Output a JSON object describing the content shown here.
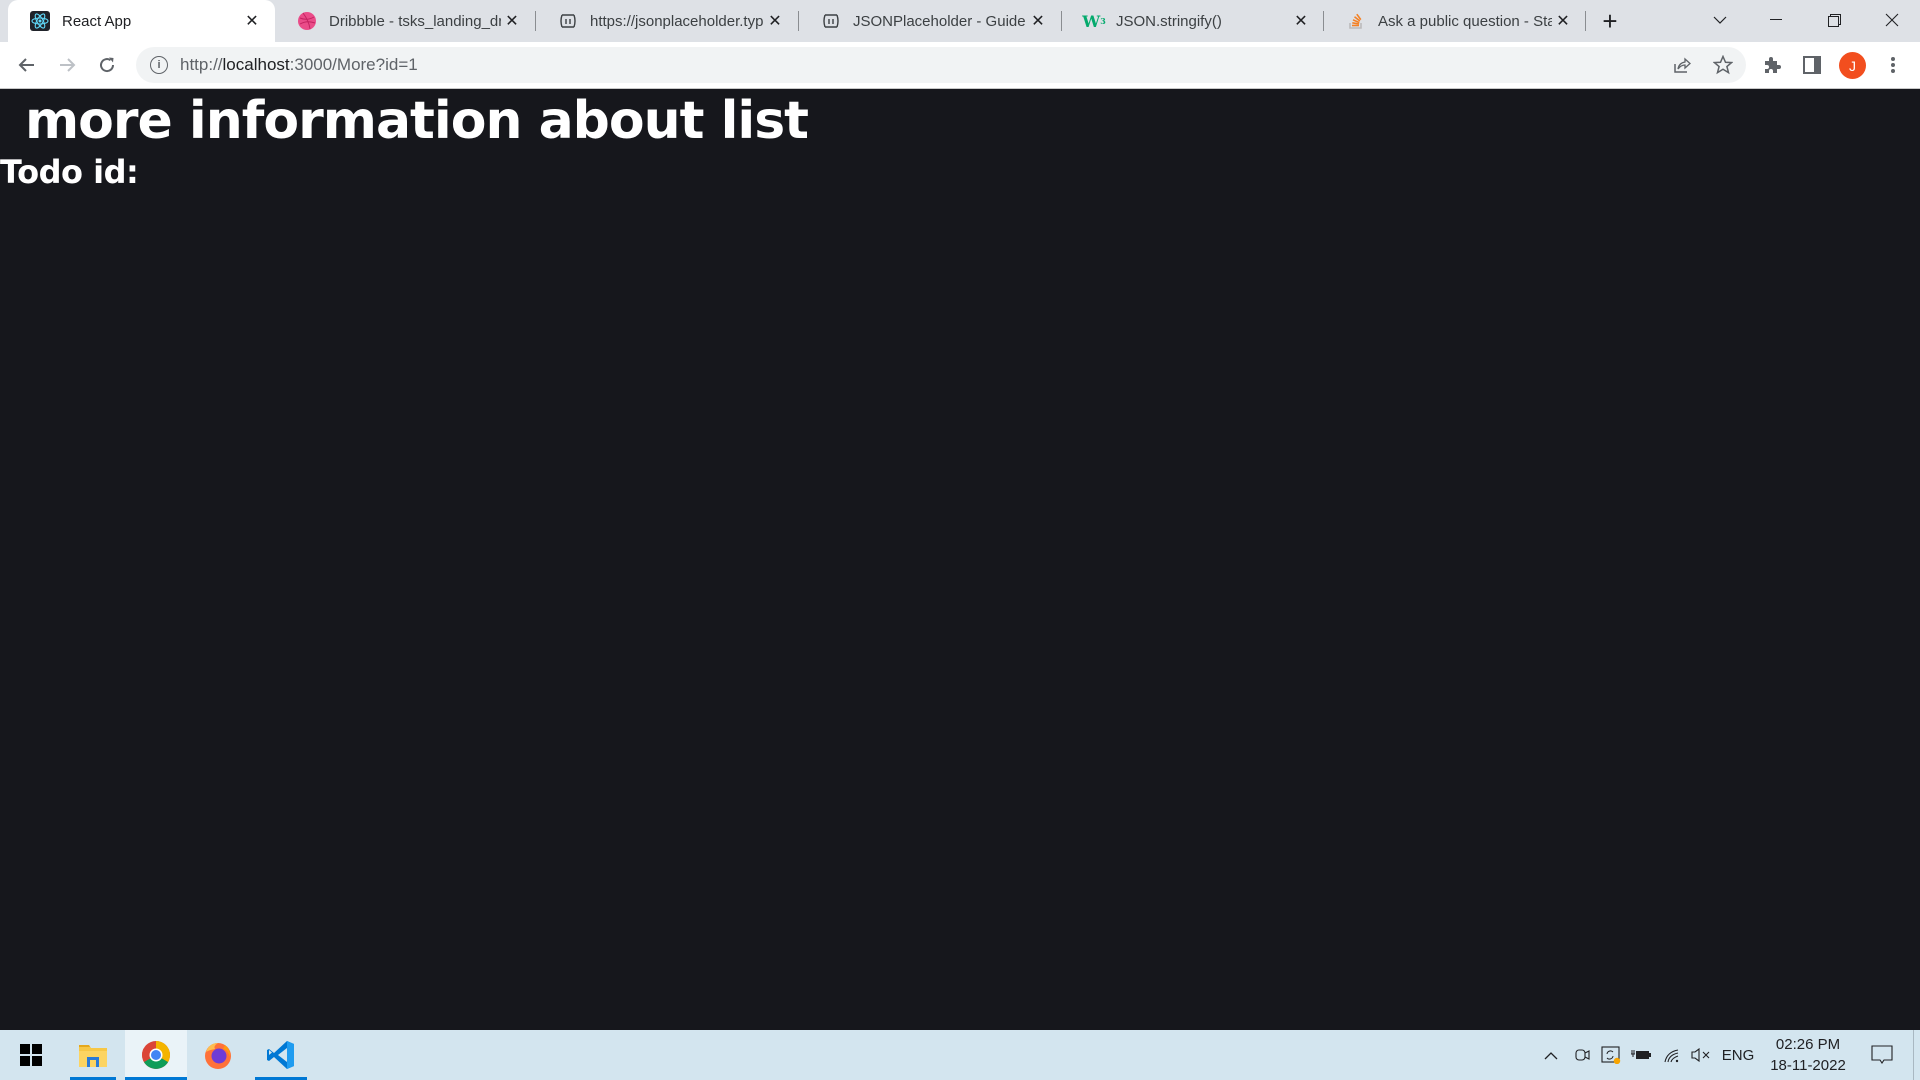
{
  "browser": {
    "tabs": [
      {
        "title": "React App",
        "icon": "react-icon",
        "active": true
      },
      {
        "title": "Dribbble - tsks_landing_dribbble",
        "icon": "dribbble-icon",
        "active": false
      },
      {
        "title": "https://jsonplaceholder.typicode.com",
        "icon": "jsonplaceholder-icon",
        "active": false
      },
      {
        "title": "JSONPlaceholder - Guide",
        "icon": "jsonplaceholder-icon",
        "active": false
      },
      {
        "title": "JSON.stringify()",
        "icon": "w3schools-icon",
        "active": false
      },
      {
        "title": "Ask a public question - Stack Overflow",
        "icon": "stackoverflow-icon",
        "active": false
      }
    ],
    "new_tab_label": "+",
    "url_prefix": "http://",
    "url_host": "localhost",
    "url_rest": ":3000/More?id=1",
    "profile_initial": "J",
    "profile_color": "#f24e1e"
  },
  "page": {
    "heading": "more information about list",
    "todo_label": "Todo id:",
    "background_color": "#16171c",
    "text_color": "#ffffff"
  },
  "taskbar": {
    "apps": [
      {
        "name": "file-explorer",
        "running": true,
        "active": false
      },
      {
        "name": "google-chrome",
        "running": true,
        "active": true
      },
      {
        "name": "firefox",
        "running": false,
        "active": false
      },
      {
        "name": "visual-studio-code",
        "running": true,
        "active": false
      }
    ],
    "language": "ENG",
    "time": "02:26 PM",
    "date": "18-11-2022"
  }
}
